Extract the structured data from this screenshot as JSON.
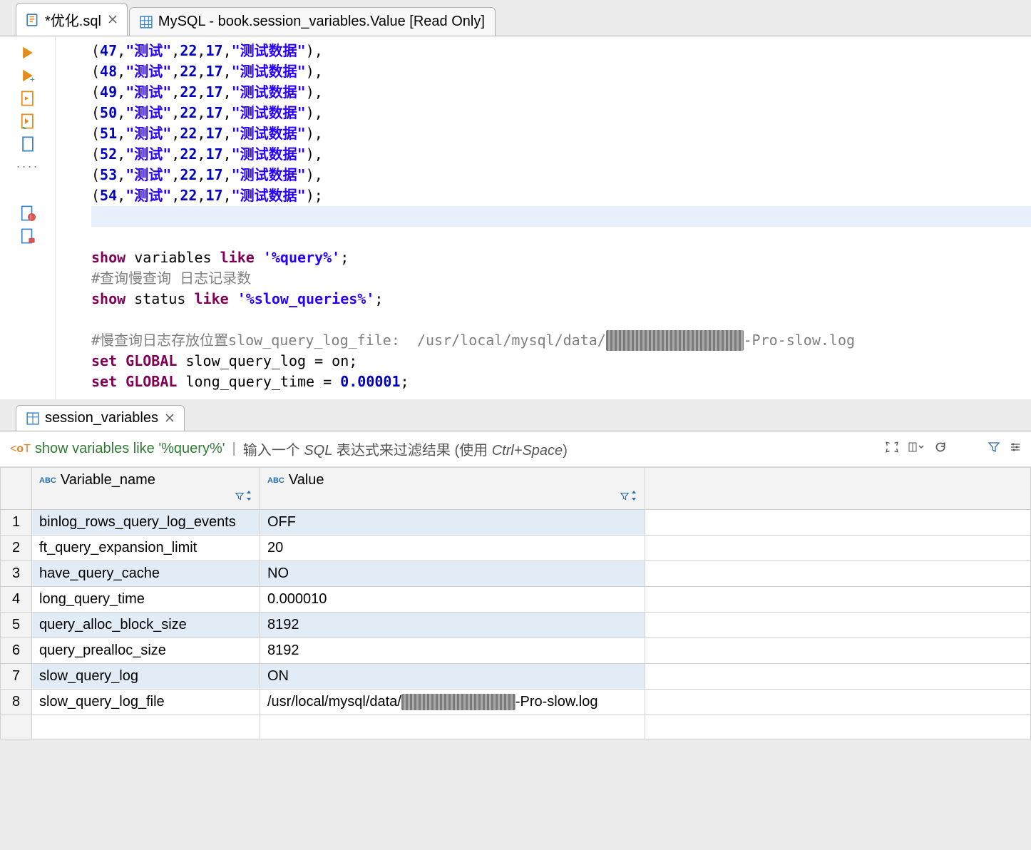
{
  "tabs": [
    {
      "label": "*优化.sql",
      "active": true
    },
    {
      "label": "MySQL - book.session_variables.Value [Read Only]",
      "active": false
    }
  ],
  "code": {
    "inserts": [
      {
        "n": 47
      },
      {
        "n": 48
      },
      {
        "n": 49
      },
      {
        "n": 50
      },
      {
        "n": 51
      },
      {
        "n": 52
      },
      {
        "n": 53
      },
      {
        "n": 54
      }
    ],
    "insert_parts": {
      "str1": "\"测试\"",
      "v1": "22",
      "v2": "17",
      "str2": "\"测试数据\""
    },
    "show_vars": {
      "kw1": "show",
      "w2": "variables",
      "kw3": "like",
      "arg": "'%query%'"
    },
    "cmt_slow": "#查询慢查询 日志记录数",
    "show_status": {
      "kw1": "show",
      "w2": "status",
      "kw3": "like",
      "arg": "'%slow_queries%'"
    },
    "cmt_loc_prefix": "#慢查询日志存放位置slow_query_log_file:  /usr/local/mysql/data/",
    "cmt_loc_mask": "xxxxxxxxxxxxxxxx",
    "cmt_loc_suffix": "-Pro-slow.log",
    "set1_kw": "set GLOBAL",
    "set1_rest": "slow_query_log = on;",
    "set2_kw": "set GLOBAL",
    "set2_rest_a": "long_query_time = ",
    "set2_num": "0.00001",
    "set2_rest_b": ";"
  },
  "panel_tab": "session_variables",
  "query_bar": {
    "text": "show variables like '%query%'",
    "hint_prefix": "输入一个 ",
    "hint_sql": "SQL",
    "hint_mid": " 表达式来过滤结果 (使用 ",
    "hint_key": "Ctrl+Space",
    "hint_suffix": ")"
  },
  "columns": [
    {
      "name": "Variable_name"
    },
    {
      "name": "Value"
    }
  ],
  "rows": [
    {
      "n": "1",
      "var": "binlog_rows_query_log_events",
      "val": "OFF"
    },
    {
      "n": "2",
      "var": "ft_query_expansion_limit",
      "val": "20"
    },
    {
      "n": "3",
      "var": "have_query_cache",
      "val": "NO"
    },
    {
      "n": "4",
      "var": "long_query_time",
      "val": "0.000010"
    },
    {
      "n": "5",
      "var": "query_alloc_block_size",
      "val": "8192"
    },
    {
      "n": "6",
      "var": "query_prealloc_size",
      "val": "8192"
    },
    {
      "n": "7",
      "var": "slow_query_log",
      "val": "ON"
    },
    {
      "n": "8",
      "var": "slow_query_log_file",
      "val_prefix": "/usr/local/mysql/data/",
      "val_mask": "xxxxxxxxxxxxxxxx",
      "val_suffix": "-Pro-slow.log"
    }
  ]
}
